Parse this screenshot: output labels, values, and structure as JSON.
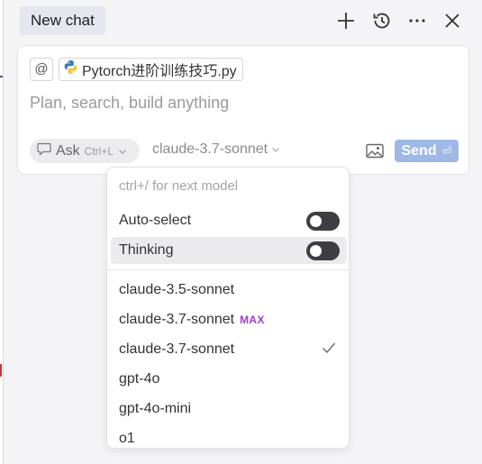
{
  "header": {
    "tab_label": "New chat",
    "icons": [
      "plus-icon",
      "history-icon",
      "more-icon",
      "close-icon"
    ]
  },
  "composer": {
    "mention_symbol": "@",
    "file_chip": {
      "icon": "python-icon",
      "label": "Pytorch进阶训练技巧.py"
    },
    "placeholder": "Plan, search, build anything",
    "mode": {
      "icon": "chat-bubble-icon",
      "label": "Ask",
      "shortcut": "Ctrl+L"
    },
    "model": {
      "label": "claude-3.7-sonnet"
    },
    "image_icon": "image-icon",
    "send": {
      "label": "Send",
      "shortcut_glyph": "⏎"
    },
    "colors": {
      "send_bg": "#9fb8e6"
    }
  },
  "model_menu": {
    "hint": "ctrl+/ for next model",
    "toggles": [
      {
        "label": "Auto-select",
        "on": false
      },
      {
        "label": "Thinking",
        "on": false
      }
    ],
    "models": [
      {
        "label": "claude-3.5-sonnet",
        "badge": "",
        "selected": false
      },
      {
        "label": "claude-3.7-sonnet",
        "badge": "MAX",
        "selected": false
      },
      {
        "label": "claude-3.7-sonnet",
        "badge": "",
        "selected": true
      },
      {
        "label": "gpt-4o",
        "badge": "",
        "selected": false
      },
      {
        "label": "gpt-4o-mini",
        "badge": "",
        "selected": false
      },
      {
        "label": "o1",
        "badge": "",
        "selected": false
      }
    ],
    "colors": {
      "max_badge": "#a03cc9",
      "toggle_off": "#3d3d42"
    }
  }
}
